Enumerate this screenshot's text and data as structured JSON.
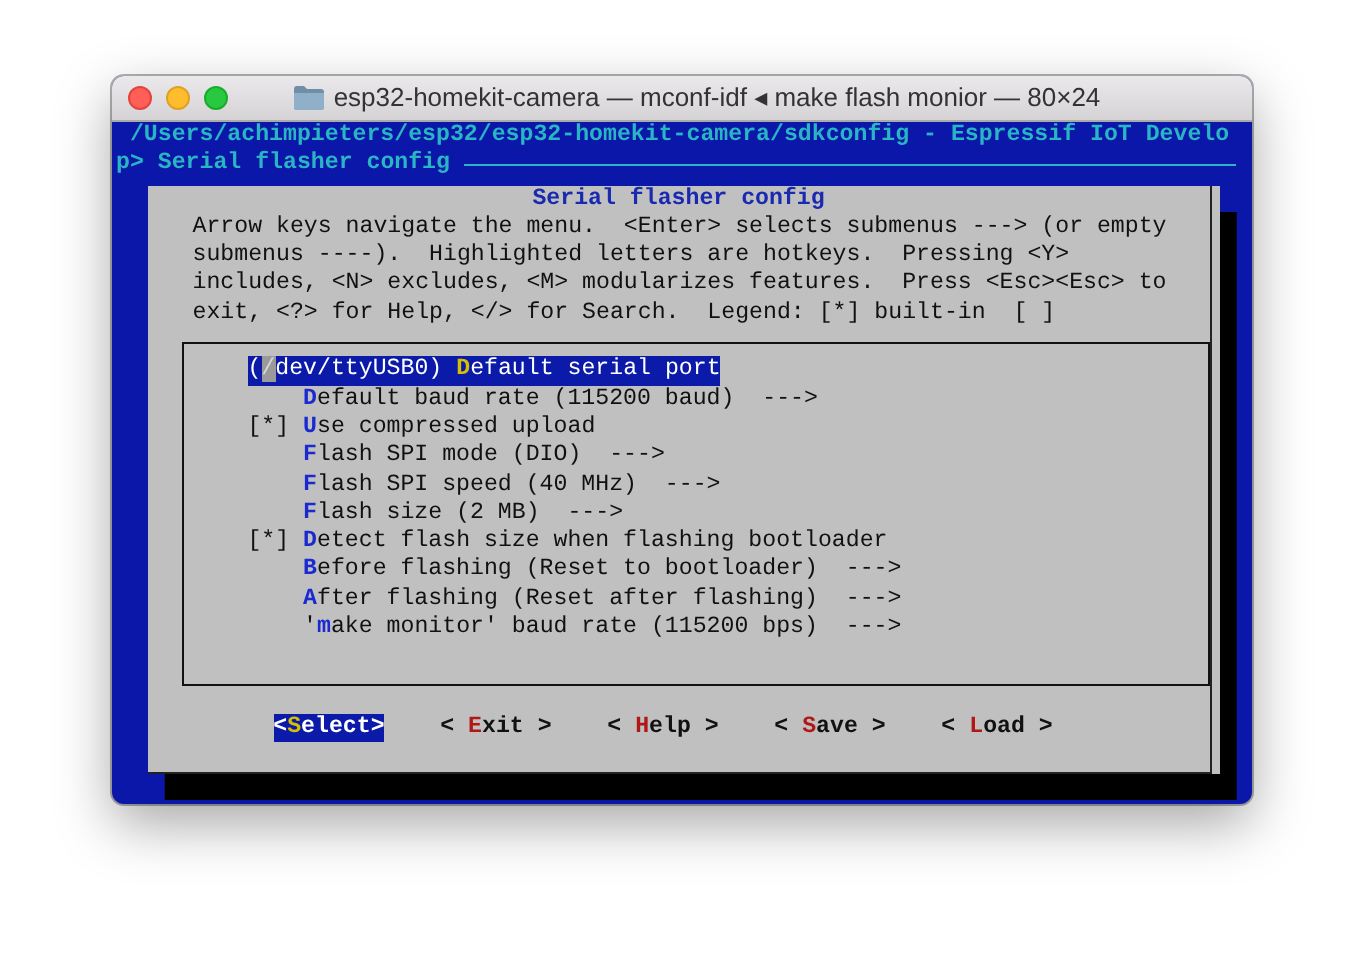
{
  "window": {
    "title": "esp32-homekit-camera — mconf-idf ◂ make flash monior — 80×24"
  },
  "terminal": {
    "header_lines": [
      "/Users/achimpieters/esp32/esp32-homekit-camera/sdkconfig - Espressif IoT Develo",
      "p> Serial flasher config"
    ],
    "dialog": {
      "title": "Serial flasher config",
      "help_lines": [
        "Arrow keys navigate the menu.  <Enter> selects submenus ---> (or empty",
        "submenus ----).  Highlighted letters are hotkeys.  Pressing <Y>",
        "includes, <N> excludes, <M> modularizes features.  Press <Esc><Esc> to",
        "exit, <?> for Help, </> for Search.  Legend: [*] built-in  [ ]"
      ],
      "items": [
        {
          "kind": "string",
          "value": "(/dev/ttyUSB0)",
          "hotkey": "D",
          "after": "efault serial port",
          "selected": true
        },
        {
          "kind": "choice",
          "hotkey": "D",
          "after": "efault baud rate (115200 baud)",
          "arrow": "--->",
          "selected": false
        },
        {
          "kind": "bool",
          "checkbox": "[*]",
          "hotkey": "U",
          "after": "se compressed upload",
          "selected": false
        },
        {
          "kind": "choice",
          "hotkey": "F",
          "after": "lash SPI mode (DIO)",
          "arrow": "--->",
          "selected": false
        },
        {
          "kind": "choice",
          "hotkey": "F",
          "after": "lash SPI speed (40 MHz)",
          "arrow": "--->",
          "selected": false
        },
        {
          "kind": "choice",
          "hotkey": "F",
          "after": "lash size (2 MB)",
          "arrow": "--->",
          "selected": false
        },
        {
          "kind": "bool",
          "checkbox": "[*]",
          "hotkey": "D",
          "after": "etect flash size when flashing bootloader",
          "selected": false
        },
        {
          "kind": "choice",
          "hotkey": "B",
          "after": "efore flashing (Reset to bootloader)",
          "arrow": "--->",
          "selected": false
        },
        {
          "kind": "choice",
          "hotkey": "A",
          "after": "fter flashing (Reset after flashing)",
          "arrow": "--->",
          "selected": false
        },
        {
          "kind": "choice",
          "before": "'",
          "hotkey": "m",
          "after": "ake monitor' baud rate (115200 bps)",
          "arrow": "--->",
          "selected": false
        }
      ],
      "buttons": [
        {
          "before": "<",
          "hotkey": "S",
          "after": "elect>",
          "selected": true
        },
        {
          "before": "< ",
          "hotkey": "E",
          "after": "xit >",
          "selected": false
        },
        {
          "before": "< ",
          "hotkey": "H",
          "after": "elp >",
          "selected": false
        },
        {
          "before": "< ",
          "hotkey": "S",
          "after": "ave >",
          "selected": false
        },
        {
          "before": "< ",
          "hotkey": "L",
          "after": "oad >",
          "selected": false
        }
      ]
    }
  }
}
